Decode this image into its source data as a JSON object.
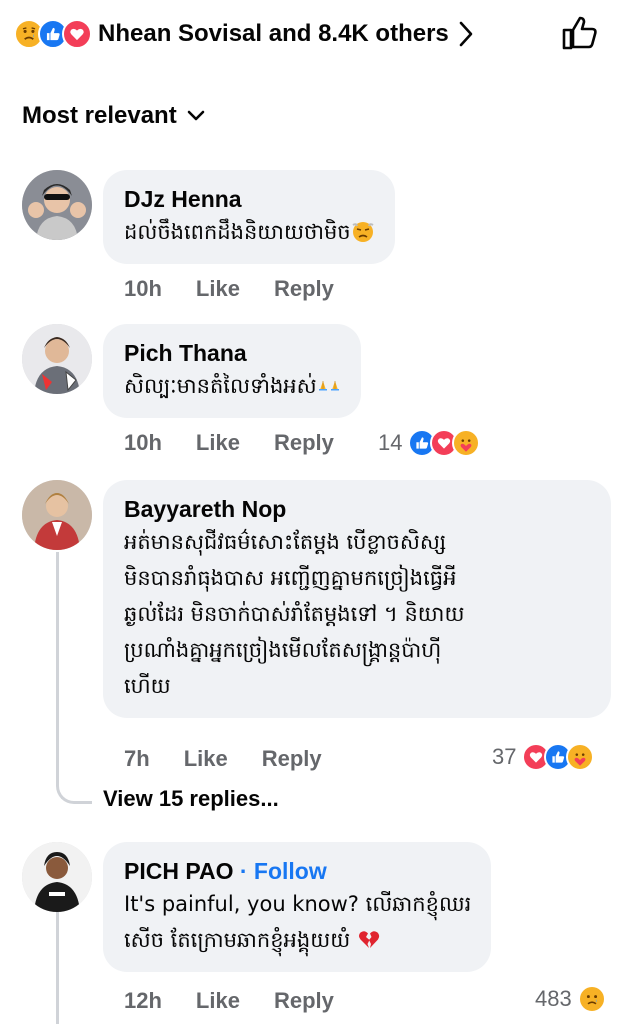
{
  "summary": {
    "reactions": [
      "sad-reaction",
      "like-reaction",
      "love-reaction"
    ],
    "text": "Nhean Sovisal and 8.4K others"
  },
  "sort": {
    "label": "Most relevant"
  },
  "comments": [
    {
      "name": "DJz Henna",
      "text": "ដល់ចឹងពេកដឹងនិយាយថាមិច",
      "emoji": "angry-sweat-emoji",
      "time": "10h",
      "like": "Like",
      "reply": "Reply"
    },
    {
      "name": "Pich Thana",
      "text": "សិល្បៈមានតំលៃទាំងអស់",
      "emoji": "praying-hands-emoji",
      "time": "10h",
      "like": "Like",
      "reply": "Reply",
      "reaction_count": "14"
    },
    {
      "name": "Bayyareth Nop",
      "lines": [
        "អត់មានសុជីវធម៌សោះតែម្តង បើខ្លាចសិស្ស",
        "មិនបានរាំធុងបាស អញ្ជើញគ្នាមកច្រៀងធ្វើអី",
        "ឆ្ងល់ដែរ មិនចាក់បាស់រាំតែម្តងទៅ ។ និយាយ",
        "ប្រណាំងគ្នាអ្នកច្រៀងមើលតែសង្គ្រាន្តប៉ាហ៊ី",
        "ហើយ"
      ],
      "time": "7h",
      "like": "Like",
      "reply": "Reply",
      "reaction_count": "37",
      "view_replies": "View 15 replies..."
    },
    {
      "name": "PICH PAO",
      "follow": "· Follow",
      "lines": [
        "It's painful, you know? លើឆាកខ្ញុំឈរ",
        "សើច តែក្រោមឆាកខ្ញុំអង្គុយយំ"
      ],
      "time": "12h",
      "like": "Like",
      "reply": "Reply",
      "reaction_count": "483"
    }
  ]
}
